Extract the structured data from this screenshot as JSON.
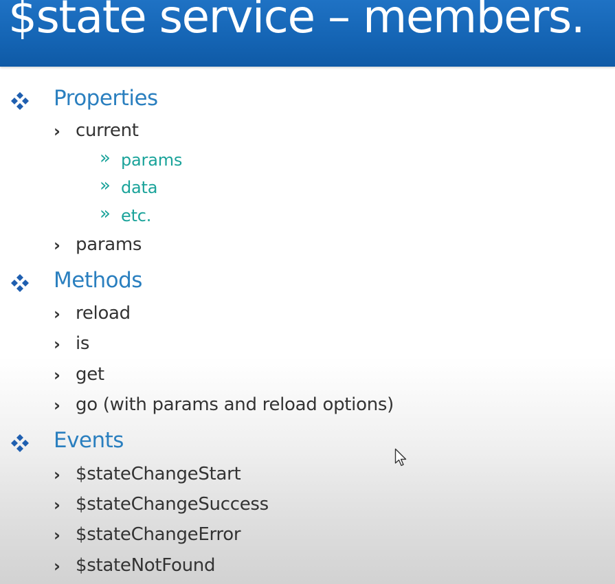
{
  "slide": {
    "title": "$state service – members.",
    "sections": [
      {
        "heading": "Properties",
        "items": [
          {
            "text": "current",
            "subitems": [
              "params",
              "data",
              "etc."
            ]
          },
          {
            "text": "params"
          }
        ]
      },
      {
        "heading": "Methods",
        "items": [
          {
            "text": "reload"
          },
          {
            "text": "is"
          },
          {
            "text": "get"
          },
          {
            "text": "go (with params and reload options)"
          }
        ]
      },
      {
        "heading": "Events",
        "items": [
          {
            "text": "$stateChangeStart"
          },
          {
            "text": "$stateChangeSuccess"
          },
          {
            "text": "$stateChangeError"
          },
          {
            "text": "$stateNotFound"
          }
        ]
      }
    ]
  },
  "icons": {
    "level1_bullet": "diamond-cluster-icon",
    "level2_bullet": "chevron-right-icon",
    "level3_bullet": "double-chevron-icon",
    "cursor": "mouse-pointer-icon"
  },
  "colors": {
    "title_bar": "#1565b5",
    "heading": "#2a7fbf",
    "body_text": "#333333",
    "sub_bullet": "#1aa39a"
  }
}
